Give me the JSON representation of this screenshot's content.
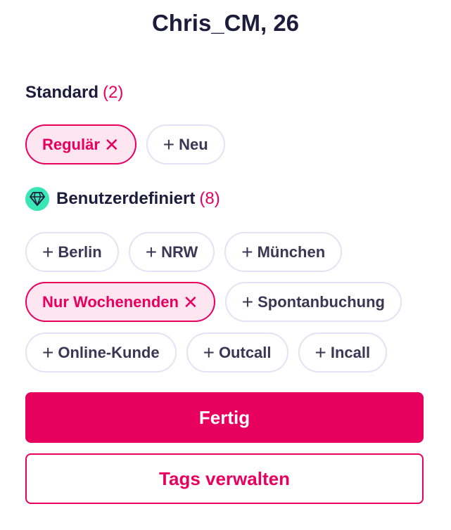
{
  "header": {
    "title": "Chris_CM, 26"
  },
  "standard": {
    "label": "Standard",
    "count": "(2)",
    "chips": [
      {
        "label": "Regulär",
        "glyph": "✕",
        "selected": true
      },
      {
        "label": "Neu",
        "glyph": "+",
        "selected": false
      }
    ]
  },
  "custom": {
    "label": "Benutzerdefiniert",
    "count": "(8)",
    "icon": "diamond-icon",
    "chips": [
      {
        "label": "Berlin",
        "glyph": "+",
        "selected": false
      },
      {
        "label": "NRW",
        "glyph": "+",
        "selected": false
      },
      {
        "label": "München",
        "glyph": "+",
        "selected": false
      },
      {
        "label": "Nur Wochenenden",
        "glyph": "✕",
        "selected": true
      },
      {
        "label": "Spontanbuchung",
        "glyph": "+",
        "selected": false
      },
      {
        "label": "Online-Kunde",
        "glyph": "+",
        "selected": false
      },
      {
        "label": "Outcall",
        "glyph": "+",
        "selected": false
      },
      {
        "label": "Incall",
        "glyph": "+",
        "selected": false
      }
    ]
  },
  "actions": {
    "done_label": "Fertig",
    "manage_label": "Tags verwalten"
  },
  "colors": {
    "accent": "#e8005f",
    "accent_soft": "#fde6ef",
    "gem": "#39e6b5",
    "chip_border": "#e6e1f5"
  }
}
